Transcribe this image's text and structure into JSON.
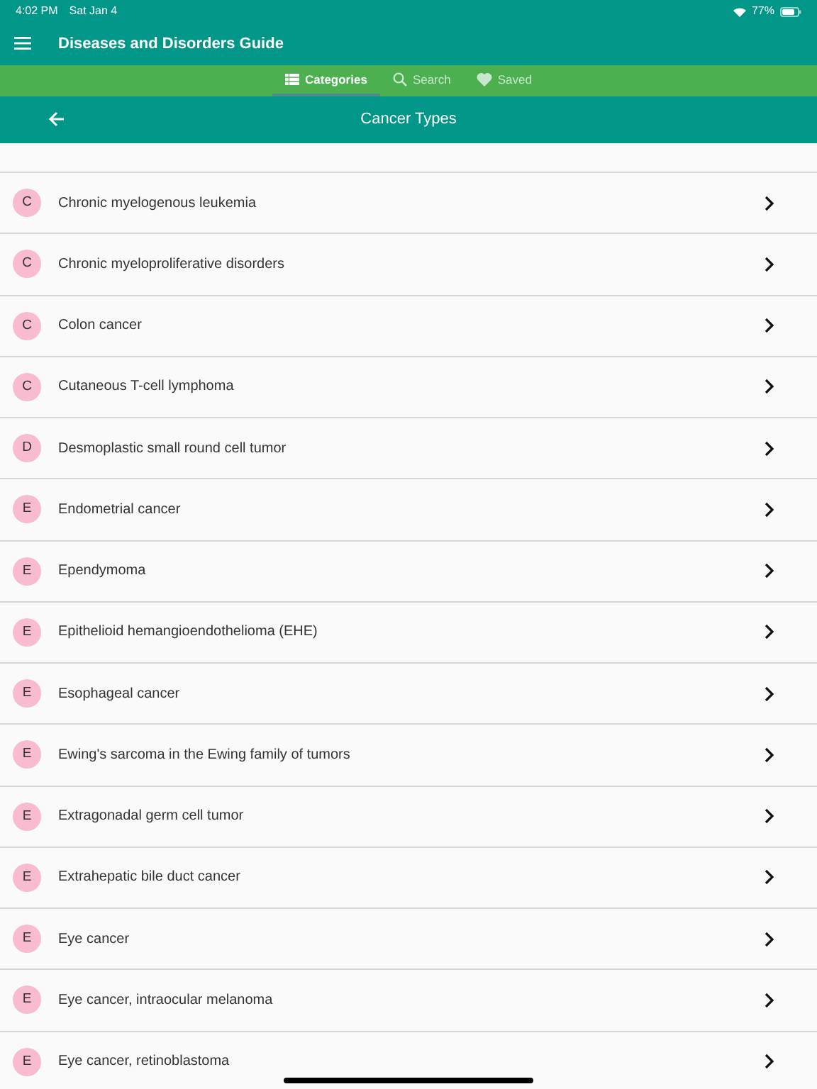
{
  "status_bar": {
    "time": "4:02 PM",
    "date": "Sat Jan 4",
    "battery": "77%"
  },
  "app_bar": {
    "title": "Diseases and Disorders Guide"
  },
  "tabs": [
    {
      "label": "Categories",
      "selected": true
    },
    {
      "label": "Search",
      "selected": false
    },
    {
      "label": "Saved",
      "selected": false
    }
  ],
  "sub_header": {
    "title": "Cancer Types"
  },
  "items": [
    {
      "letter": "C",
      "label": "Chronic myelogenous leukemia"
    },
    {
      "letter": "C",
      "label": "Chronic myeloproliferative disorders"
    },
    {
      "letter": "C",
      "label": "Colon cancer"
    },
    {
      "letter": "C",
      "label": "Cutaneous T-cell lymphoma"
    },
    {
      "letter": "D",
      "label": "Desmoplastic small round cell tumor"
    },
    {
      "letter": "E",
      "label": "Endometrial cancer"
    },
    {
      "letter": "E",
      "label": "Ependymoma"
    },
    {
      "letter": "E",
      "label": "Epithelioid hemangioendothelioma (EHE)"
    },
    {
      "letter": "E",
      "label": "Esophageal cancer"
    },
    {
      "letter": "E",
      "label": "Ewing's sarcoma in the Ewing family of tumors"
    },
    {
      "letter": "E",
      "label": "Extragonadal germ cell tumor"
    },
    {
      "letter": "E",
      "label": "Extrahepatic bile duct cancer"
    },
    {
      "letter": "E",
      "label": "Eye cancer"
    },
    {
      "letter": "E",
      "label": "Eye cancer, intraocular melanoma"
    },
    {
      "letter": "E",
      "label": "Eye cancer, retinoblastoma"
    }
  ]
}
